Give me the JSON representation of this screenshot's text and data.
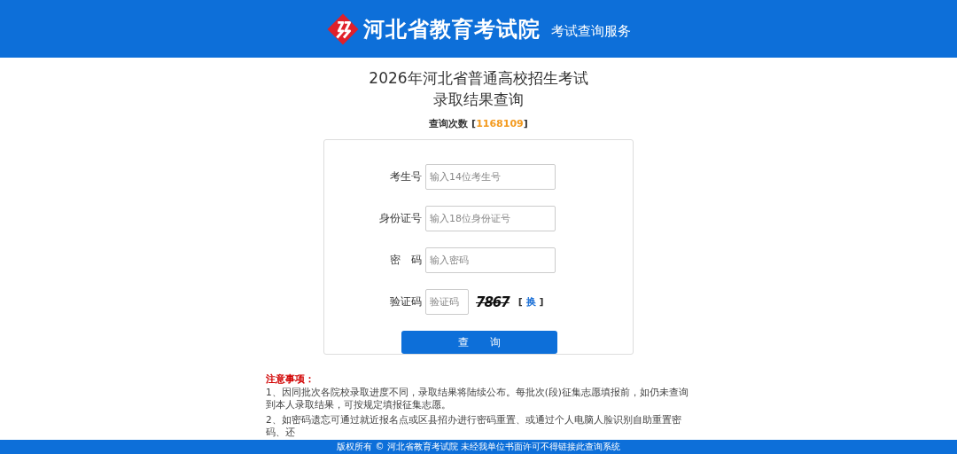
{
  "header": {
    "title": "河北省教育考试院",
    "subtitle": "考试查询服务"
  },
  "page_title": [
    "2026年河北省普通高校招生考试",
    "录取结果查询"
  ],
  "query_count": {
    "label": "查询次数",
    "open": "[",
    "value": "1168109",
    "close": "]"
  },
  "form": {
    "fields": [
      {
        "kind": "text",
        "label": "考生号",
        "placeholder": "输入14位考生号"
      },
      {
        "kind": "text",
        "label": "身份证号",
        "placeholder": "输入18位身份证号"
      },
      {
        "kind": "text",
        "label": "密　码",
        "placeholder": "输入密码"
      },
      {
        "kind": "captcha",
        "label": "验证码",
        "placeholder": "验证码",
        "captcha": "7867",
        "open": "[",
        "refresh": "换",
        "close": "]"
      }
    ],
    "submit": "查　　询"
  },
  "notes": {
    "title": "注意事项：",
    "items": [
      "1、因同批次各院校录取进度不同，录取结果将陆续公布。每批次(段)征集志愿填报前，如仍未查询到本人录取结果，可按规定填报征集志愿。",
      "2、如密码遗忘可通过就近报名点或区县招办进行密码重置、或通过个人电脑人脸识别自助重置密码、还"
    ]
  },
  "footer": "版权所有 © 河北省教育考试院 未经我单位书面许可不得链接此查询系统"
}
